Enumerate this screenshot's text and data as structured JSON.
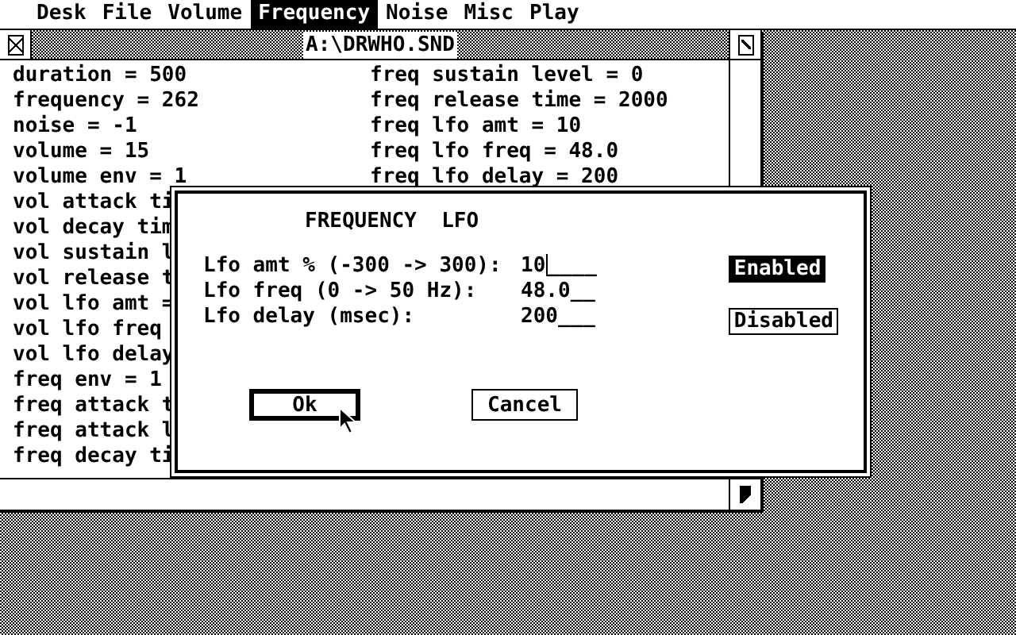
{
  "menu_bar": [
    {
      "label": "Desk",
      "selected": false
    },
    {
      "label": "File",
      "selected": false
    },
    {
      "label": "Volume",
      "selected": false
    },
    {
      "label": "Frequency",
      "selected": true
    },
    {
      "label": "Noise",
      "selected": false
    },
    {
      "label": "Misc",
      "selected": false
    },
    {
      "label": "Play",
      "selected": false
    }
  ],
  "window": {
    "title": "A:\\DRWHO.SND",
    "left_column": [
      "duration = 500",
      "frequency = 262",
      "noise = -1",
      "volume = 15",
      "volume env = 1",
      "vol attack ti",
      "vol decay tim",
      "vol sustain l",
      "vol release t",
      "vol lfo amt =",
      "vol lfo freq",
      "vol lfo delay",
      "freq env = 1",
      "freq attack t",
      "freq attack l",
      "freq decay ti"
    ],
    "right_column": [
      "freq sustain level = 0",
      "freq release time = 2000",
      "freq lfo amt = 10",
      "freq lfo freq = 48.0",
      "freq lfo delay = 200"
    ]
  },
  "dialog": {
    "title": "FREQUENCY  LFO",
    "fields": [
      {
        "label": "Lfo amt % (-300 -> 300):",
        "value": "10",
        "blank": "____",
        "focused": true
      },
      {
        "label": "Lfo freq (0 -> 50 Hz):",
        "value": "48.0",
        "blank": "__",
        "focused": false
      },
      {
        "label": "Lfo delay (msec):",
        "value": "200",
        "blank": "___",
        "focused": false
      }
    ],
    "toggles": [
      {
        "label": "Enabled",
        "selected": true
      },
      {
        "label": "Disabled",
        "selected": false
      }
    ],
    "buttons": [
      {
        "label": "Ok",
        "default": true
      },
      {
        "label": "Cancel",
        "default": false
      }
    ]
  }
}
